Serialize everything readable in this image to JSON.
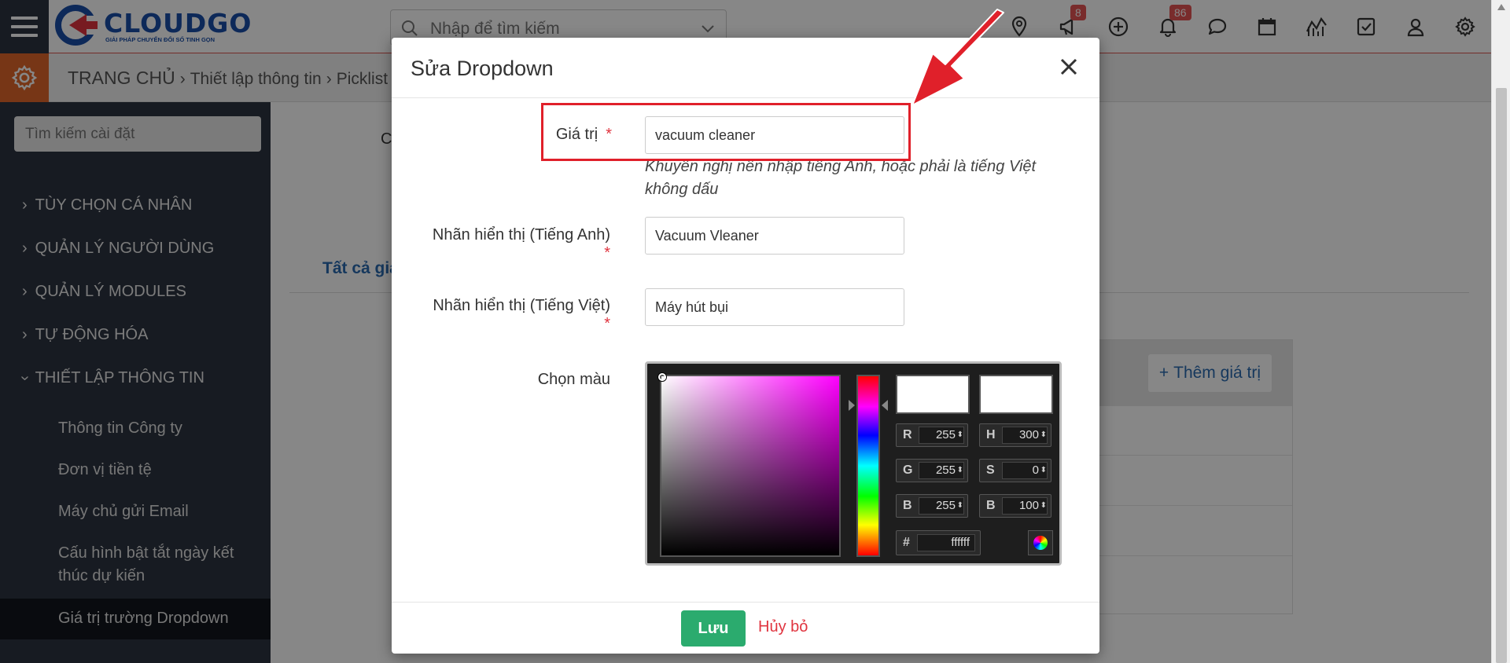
{
  "brand": {
    "name": "CLOUDGO",
    "tagline": "GIẢI PHÁP CHUYỂN ĐỔI SỐ TINH GỌN"
  },
  "topbar": {
    "search_placeholder": "Nhập để tìm kiếm",
    "icons": [
      "location-icon",
      "megaphone-icon",
      "plus-circle-icon",
      "bell-icon",
      "chat-icon",
      "calendar-icon",
      "chart-icon",
      "checkbox-icon",
      "user-icon",
      "gear-icon"
    ],
    "announcements_badge": "8",
    "notifications_badge": "86"
  },
  "breadcrumb": {
    "home": "TRANG CHỦ",
    "level1": "Thiết lập thông tin",
    "level2": "Picklist"
  },
  "sidebar": {
    "search_placeholder": "Tìm kiếm cài đặt",
    "sections": [
      {
        "label": "TÙY CHỌN CÁ NHÂN"
      },
      {
        "label": "QUẢN LÝ NGƯỜI DÙNG"
      },
      {
        "label": "QUẢN LÝ MODULES"
      },
      {
        "label": "TỰ ĐỘNG HÓA"
      },
      {
        "label": "THIẾT LẬP THÔNG TIN"
      }
    ],
    "sub_items": [
      {
        "label": "Thông tin Công ty"
      },
      {
        "label": "Đơn vị tiền tệ"
      },
      {
        "label": "Máy chủ gửi Email"
      },
      {
        "label": "Cấu hình bật tắt ngày kết thúc dự kiến"
      },
      {
        "label": "Giá trị trường Dropdown"
      }
    ]
  },
  "background": {
    "partial_label": "C",
    "tab_label": "Tất cả giá",
    "add_value_label": "Thêm giá trị"
  },
  "modal": {
    "title": "Sửa Dropdown",
    "value_label": "Giá trị",
    "value": "vacuum cleaner",
    "hint": "Khuyến nghị nên nhập tiếng Anh, hoặc phải là tiếng Việt không dấu",
    "label_en": "Nhãn hiển thị (Tiếng Anh)",
    "value_en": "Vacuum Vleaner",
    "label_vi": "Nhãn hiển thị (Tiếng Việt)",
    "value_vi": "Máy hút bụi",
    "color_label": "Chọn màu",
    "required_mark": "*",
    "save_label": "Lưu",
    "cancel_label": "Hủy bỏ"
  },
  "color_picker": {
    "r_label": "R",
    "r": "255",
    "g_label": "G",
    "g": "255",
    "b_label": "B",
    "b": "255",
    "h_label": "H",
    "h": "300",
    "s_label": "S",
    "s": "0",
    "v_label": "B",
    "v": "100",
    "hex_label": "#",
    "hex": "ffffff"
  },
  "colors": {
    "sidebar_bg": "#2c3440",
    "accent_orange": "#e0672a",
    "brand_blue": "#1a4ea8",
    "save_green": "#2bab6e",
    "danger_red": "#e0343f",
    "annotation_red": "#e0202a"
  }
}
